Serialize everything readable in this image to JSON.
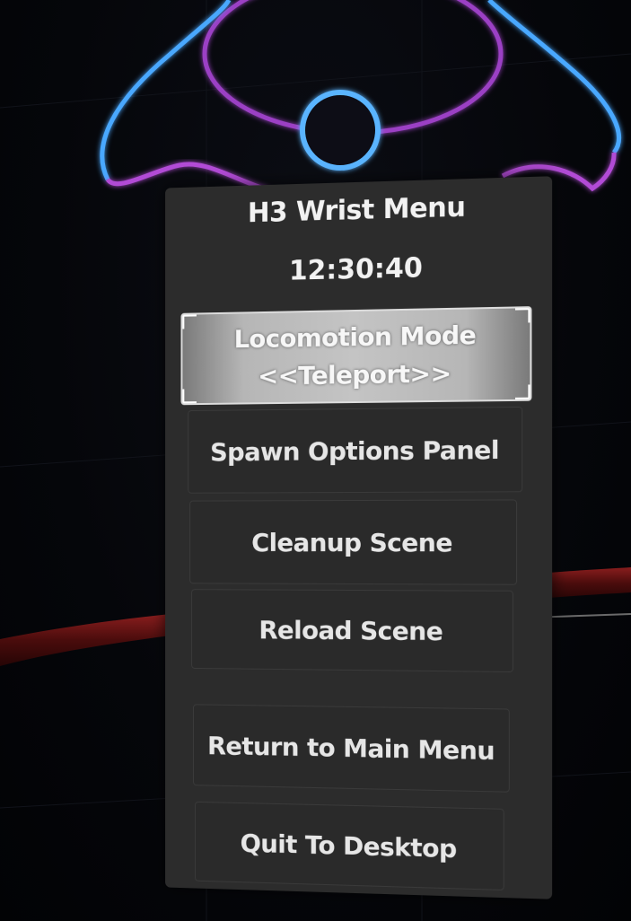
{
  "menu": {
    "title": "H3 Wrist Menu",
    "clock": "12:30:40",
    "locomotion": {
      "label": "Locomotion Mode",
      "value": "<<Teleport>>"
    },
    "buttons": [
      {
        "label": "Spawn Options Panel"
      },
      {
        "label": "Cleanup Scene"
      },
      {
        "label": "Reload Scene"
      },
      {
        "label": "Return to Main Menu"
      },
      {
        "label": "Quit To Desktop"
      }
    ]
  },
  "colors": {
    "panel_bg": "#2c2c2c",
    "button_bg": "#2a2a2a",
    "selected_bg": "#b6b6b6",
    "text": "#f2f2f2",
    "controller_ring_blue": "#4aa8ff",
    "controller_ring_purple": "#b24bd6",
    "rail_red": "#5a1010"
  },
  "icons": {
    "controller_ring": "vr-controller-ring-icon",
    "controller_hub": "vr-controller-hub-icon"
  }
}
